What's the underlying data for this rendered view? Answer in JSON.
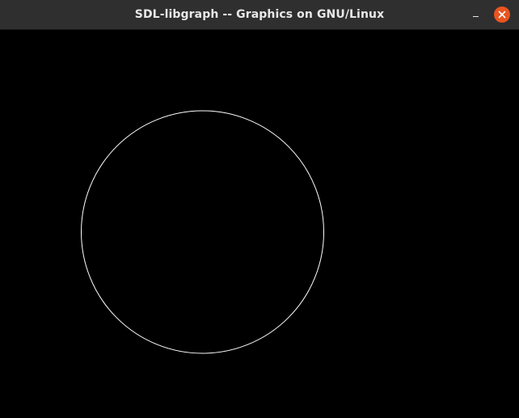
{
  "window": {
    "title": "SDL-libgraph -- Graphics on GNU/Linux"
  },
  "titlebar_buttons": [
    {
      "name": "minimize",
      "icon": "minimize-icon"
    },
    {
      "name": "close",
      "icon": "close-icon",
      "color": "#e95420"
    }
  ],
  "canvas": {
    "background": "#000000",
    "shapes": [
      {
        "type": "circle",
        "stroke": "#ffffff",
        "fill": "none"
      }
    ]
  }
}
